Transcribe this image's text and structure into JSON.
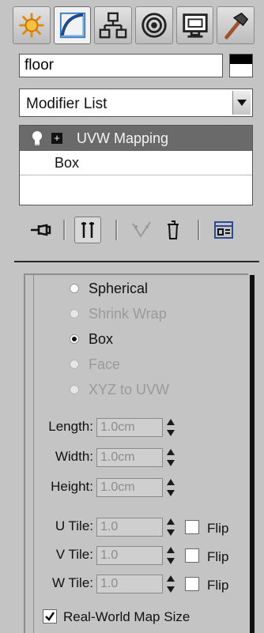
{
  "tabs": [
    {
      "name": "create",
      "icon": "sun-icon",
      "active": false
    },
    {
      "name": "modify",
      "icon": "curve-icon",
      "active": true
    },
    {
      "name": "hierarchy",
      "icon": "hierarchy-icon",
      "active": false
    },
    {
      "name": "motion",
      "icon": "motion-icon",
      "active": false
    },
    {
      "name": "display",
      "icon": "monitor-icon",
      "active": false
    },
    {
      "name": "utilities",
      "icon": "hammer-icon",
      "active": false
    }
  ],
  "object": {
    "name_value": "floor",
    "color": "#000000"
  },
  "modifier_list": {
    "selected": "Modifier List"
  },
  "stack": {
    "items": [
      {
        "label": "UVW Mapping",
        "selected": true
      },
      {
        "label": "Box",
        "selected": false
      }
    ]
  },
  "mapping": {
    "options": [
      {
        "label": "Spherical",
        "checked": false,
        "enabled": true
      },
      {
        "label": "Shrink Wrap",
        "checked": false,
        "enabled": false
      },
      {
        "label": "Box",
        "checked": true,
        "enabled": true
      },
      {
        "label": "Face",
        "checked": false,
        "enabled": false
      },
      {
        "label": "XYZ to UVW",
        "checked": false,
        "enabled": false
      }
    ],
    "length": {
      "label": "Length:",
      "value": "1.0cm"
    },
    "width": {
      "label": "Width:",
      "value": "1.0cm"
    },
    "height": {
      "label": "Height:",
      "value": "1.0cm"
    },
    "u_tile": {
      "label": "U Tile:",
      "value": "1.0",
      "flip_label": "Flip",
      "flip": false
    },
    "v_tile": {
      "label": "V Tile:",
      "value": "1.0",
      "flip_label": "Flip",
      "flip": false
    },
    "w_tile": {
      "label": "W Tile:",
      "value": "1.0",
      "flip_label": "Flip",
      "flip": false
    },
    "real_world": {
      "label": "Real-World Map Size",
      "checked": true
    }
  },
  "colors": {
    "accent_selected_row": "#6a6a6a",
    "panel_bg": "#c4c4c4",
    "create_icon": "#f0a020",
    "modify_icon": "#2a6ab0"
  }
}
